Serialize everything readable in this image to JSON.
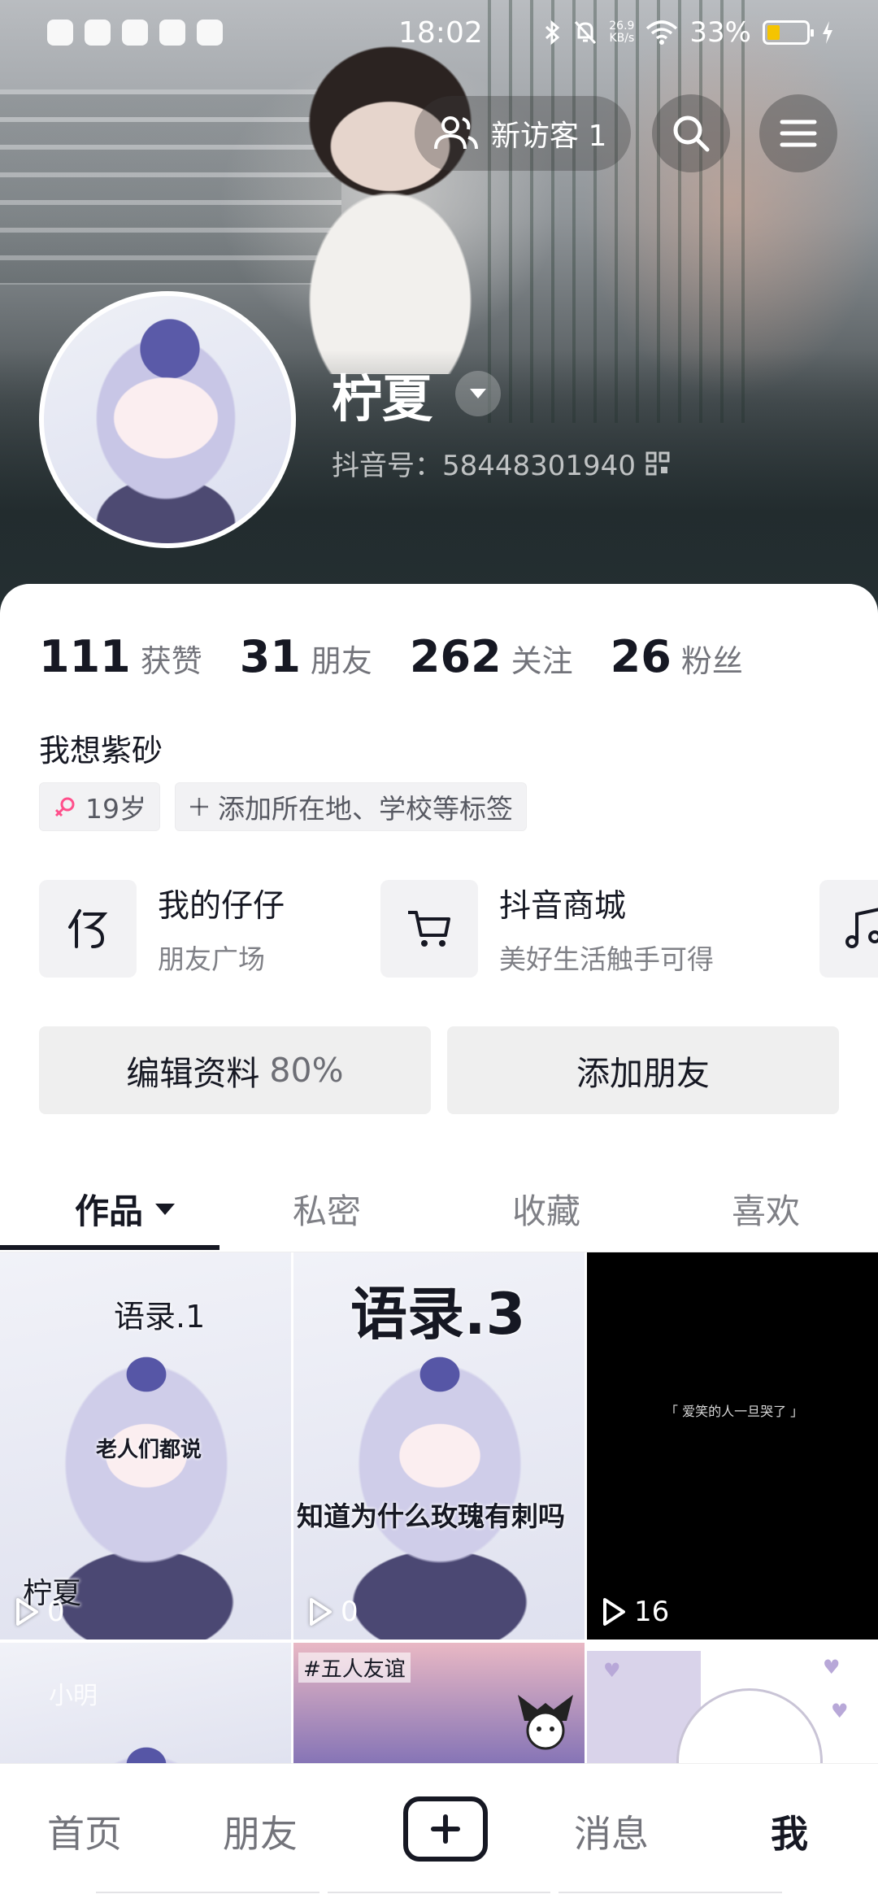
{
  "status_bar": {
    "time": "18:02",
    "net_speed": "26.9",
    "net_unit": "KB/s",
    "battery": "33%",
    "battery_level": 0.33,
    "battery_color": "#f5c400"
  },
  "header": {
    "visitor_label": "新访客 1",
    "search_icon": "search-icon",
    "menu_icon": "hamburger-menu-icon"
  },
  "profile": {
    "name": "柠夏",
    "douyin_id": "抖音号：58448301940",
    "bio": "我想紫砂",
    "gender_age": "19岁",
    "add_tags": "添加所在地、学校等标签"
  },
  "stats": [
    {
      "num": "111",
      "label": "获赞"
    },
    {
      "num": "31",
      "label": "朋友"
    },
    {
      "num": "262",
      "label": "关注"
    },
    {
      "num": "26",
      "label": "粉丝"
    }
  ],
  "features": [
    {
      "title": "我的仔仔",
      "sub": "朋友广场",
      "icon": "zaizai-icon"
    },
    {
      "title": "抖音商城",
      "sub": "美好生活触手可得",
      "icon": "cart-icon"
    }
  ],
  "buttons": {
    "edit_profile": "编辑资料",
    "edit_percent": "80%",
    "add_friend": "添加朋友"
  },
  "tabs": [
    "作品",
    "私密",
    "收藏",
    "喜欢"
  ],
  "videos": [
    {
      "top_caption": "语录.1",
      "mid_caption": "老人们都说",
      "bottom_caption": "柠夏",
      "plays": "0"
    },
    {
      "top_caption": "语录.3",
      "mid_caption": "知道为什么玫瑰有刺吗",
      "plays": "0"
    },
    {
      "mid_caption": "「 爱笑的人一旦哭了 」",
      "plays": "16"
    },
    {
      "caption": "小明"
    },
    {
      "caption": "#五人友谊"
    },
    {
      "caption": ""
    }
  ],
  "bottom_nav": [
    "首页",
    "朋友",
    "消息",
    "我"
  ],
  "colors": {
    "text_primary": "#161823",
    "tag_bg": "#f2f2f4",
    "gender_icon": "#ff4f8b"
  }
}
